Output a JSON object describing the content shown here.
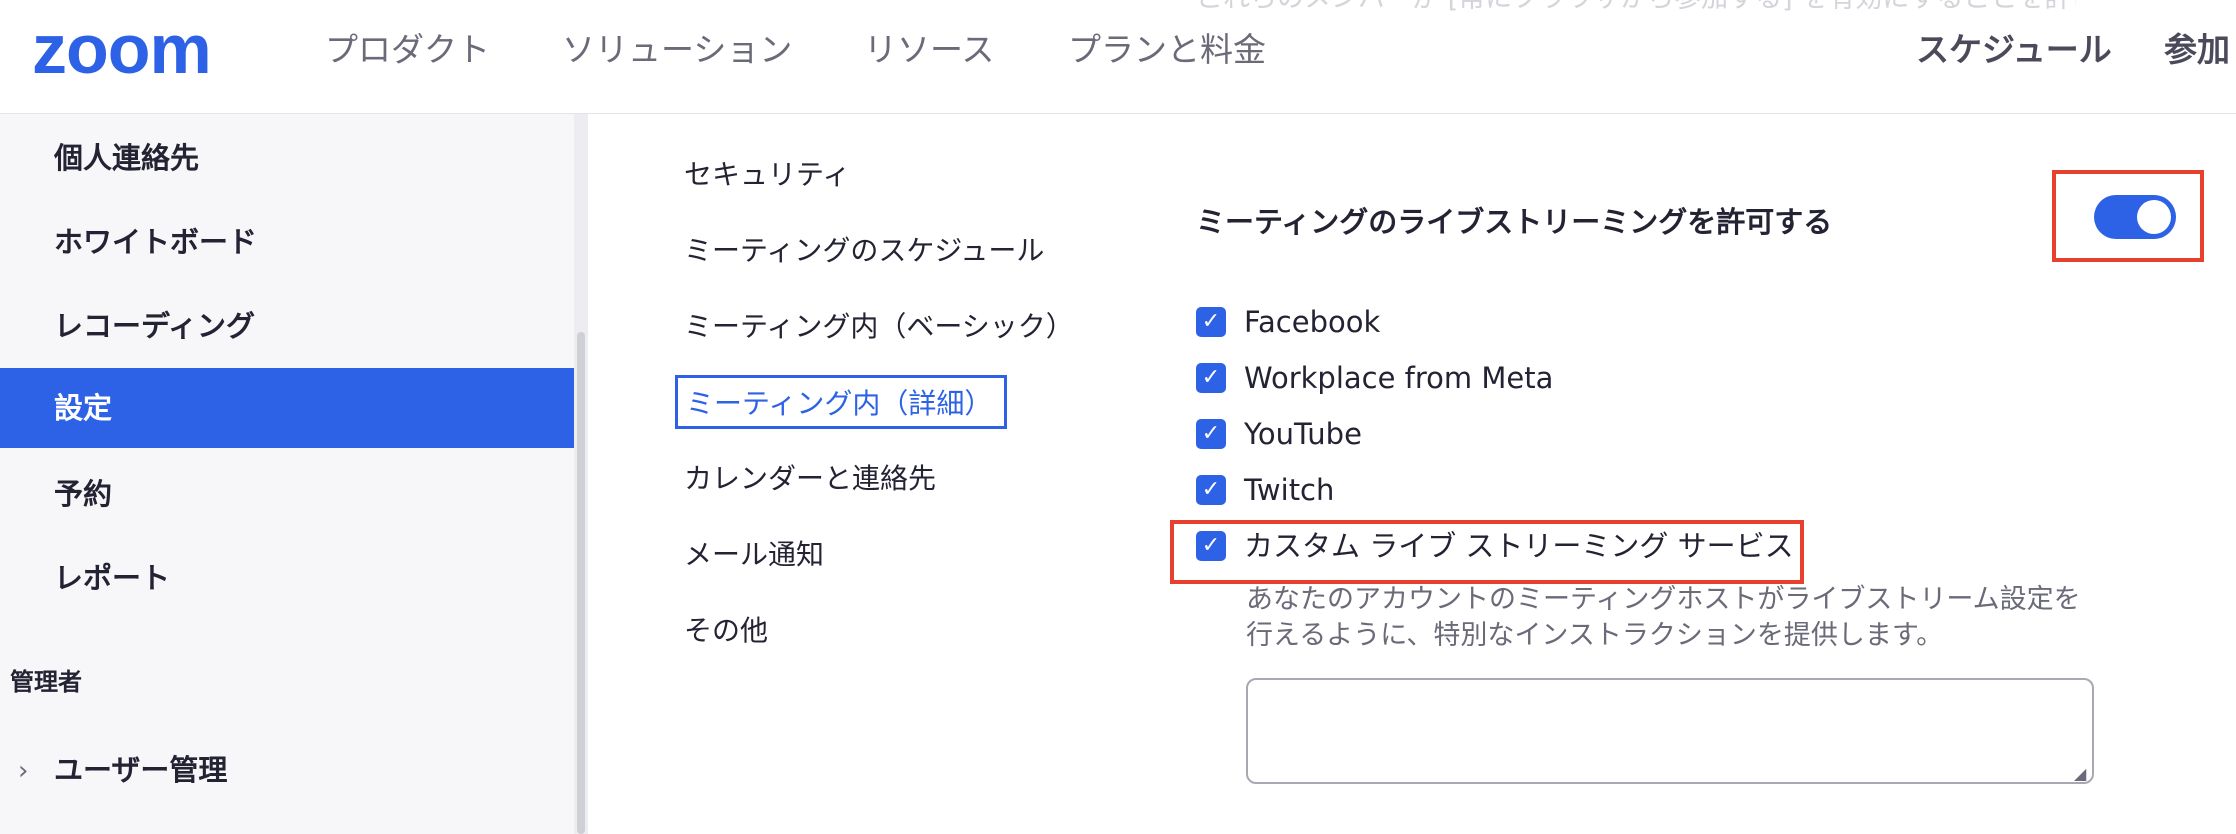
{
  "topnav": {
    "logo": "zoom",
    "faded_text": "これらのメンバーが [常にブラウザから参加する] を有効にすることを許可します。",
    "items": [
      "プロダクト",
      "ソリューション",
      "リソース",
      "プランと料金"
    ],
    "schedule": "スケジュール",
    "join": "参加"
  },
  "sidebar": {
    "items": [
      {
        "label": "個人連絡先"
      },
      {
        "label": "ホワイトボード"
      },
      {
        "label": "レコーディング"
      },
      {
        "label": "設定"
      },
      {
        "label": "予約"
      },
      {
        "label": "レポート"
      }
    ],
    "admin_heading": "管理者",
    "admin_items": [
      {
        "label": "ユーザー管理"
      }
    ]
  },
  "subnav": {
    "items": [
      {
        "label": "セキュリティ"
      },
      {
        "label": "ミーティングのスケジュール"
      },
      {
        "label": "ミーティング内（ベーシック）"
      },
      {
        "label": "ミーティング内（詳細）"
      },
      {
        "label": "カレンダーと連絡先"
      },
      {
        "label": "メール通知"
      },
      {
        "label": "その他"
      }
    ],
    "active_index": 3
  },
  "setting": {
    "title": "ミーティングのライブストリーミングを許可する",
    "enabled": true,
    "options": [
      {
        "label": "Facebook",
        "checked": true
      },
      {
        "label": "Workplace from Meta",
        "checked": true
      },
      {
        "label": "YouTube",
        "checked": true
      },
      {
        "label": "Twitch",
        "checked": true
      },
      {
        "label": "カスタム ライブ ストリーミング サービス",
        "checked": true
      }
    ],
    "custom_description": "あなたのアカウントのミーティングホストがライブストリーム設定を行えるように、特別なインストラクションを提供します。",
    "instructions_value": ""
  },
  "colors": {
    "accent": "#2d62e6",
    "highlight": "#e8402e"
  }
}
